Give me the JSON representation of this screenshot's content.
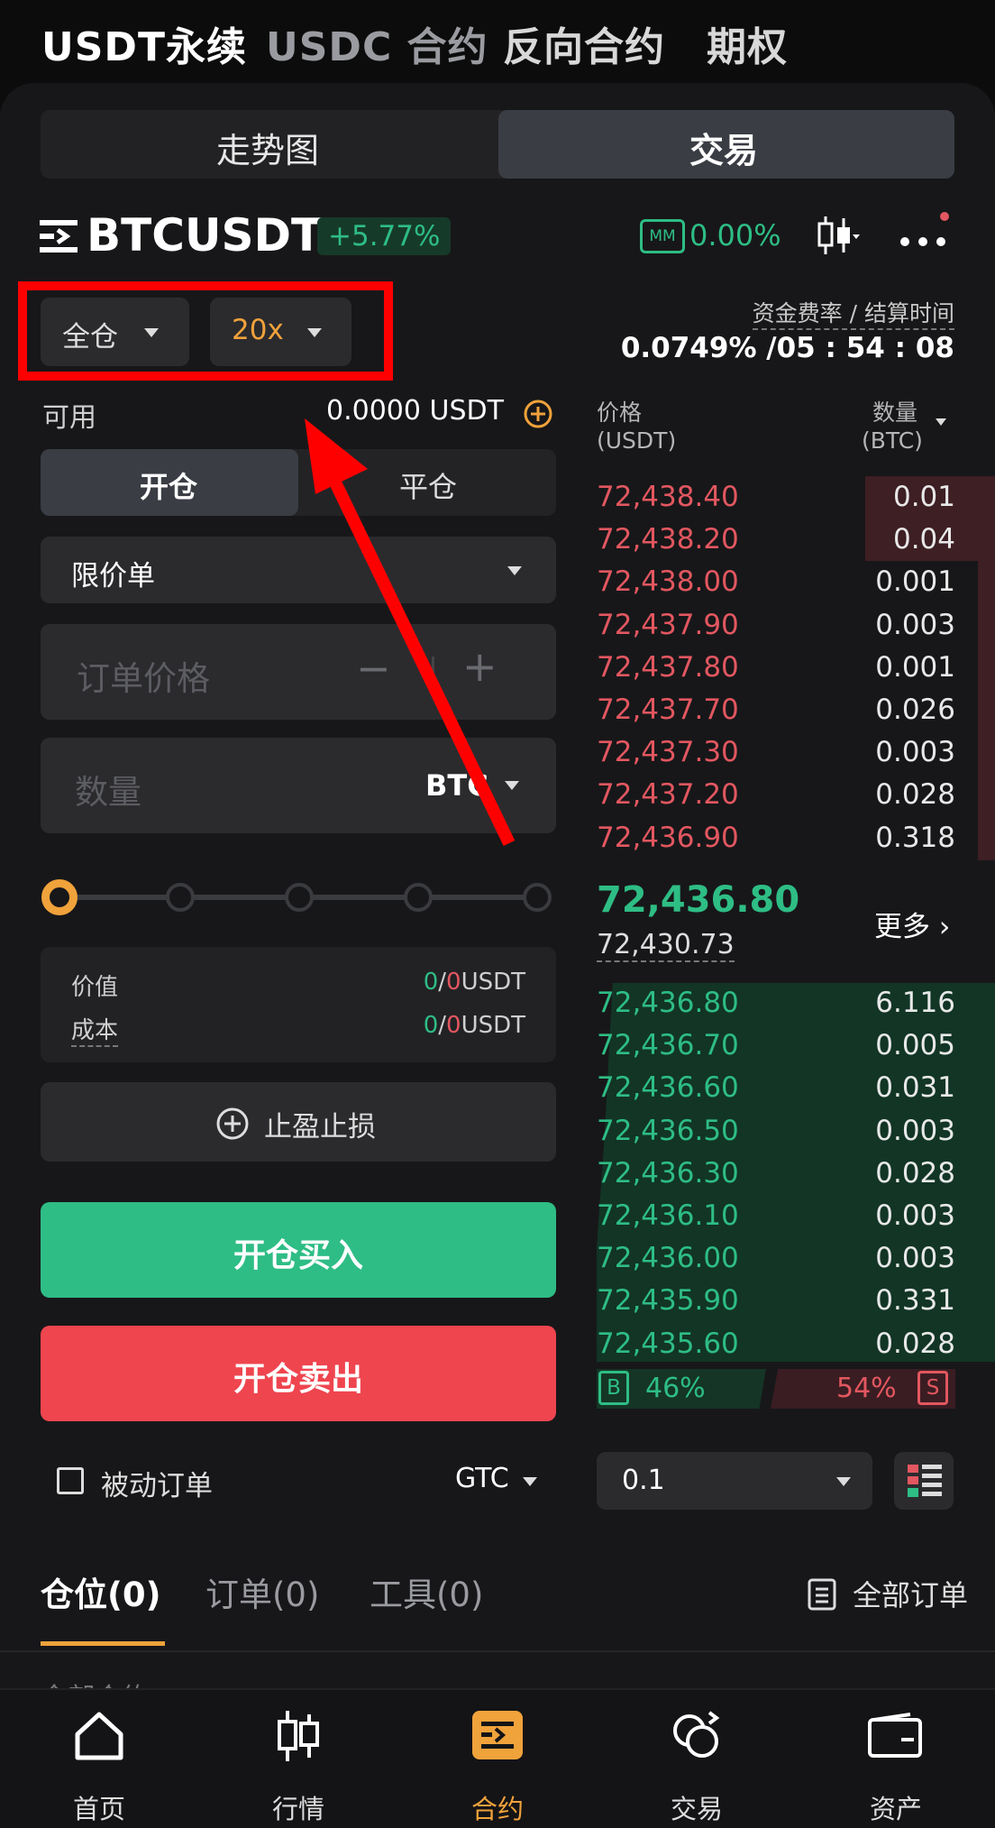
{
  "top_tabs": [
    "USDT永续",
    "USDC 合约",
    "反向合约",
    "期权"
  ],
  "view_tabs": {
    "chart": "走势图",
    "trade": "交易"
  },
  "symbol": {
    "name": "BTCUSDT",
    "change": "+5.77%",
    "mm_badge": "MM",
    "mm_value": "0.00%"
  },
  "margin": {
    "mode": "全仓",
    "leverage": "20x"
  },
  "funding": {
    "label": "资金费率 / 结算时间",
    "value": "0.0749% /05 : 54 : 08"
  },
  "available": {
    "label": "可用",
    "value": "0.0000 USDT"
  },
  "open_close": {
    "open": "开仓",
    "close": "平仓"
  },
  "order_type": "限价单",
  "price_input": {
    "placeholder": "订单价格",
    "minus": "−",
    "plus": "+"
  },
  "qty_input": {
    "placeholder": "数量",
    "unit": "BTC"
  },
  "slider_fraction": 0,
  "value_box": {
    "value_label": "价值",
    "value_green": "0",
    "value_slash": "/",
    "value_red": "0",
    "value_unit": "USDT",
    "cost_label": "成本",
    "cost_green": "0",
    "cost_slash": "/",
    "cost_red": "0",
    "cost_unit": "USDT"
  },
  "tpsl": "止盈止损",
  "buy_label": "开仓买入",
  "sell_label": "开仓卖出",
  "passive": {
    "label": "被动订单",
    "tif": "GTC"
  },
  "orderbook": {
    "price_header": "价格",
    "price_unit": "(USDT)",
    "qty_header": "数量",
    "qty_unit": "(BTC)",
    "asks": [
      [
        "72,438.40",
        "0.01"
      ],
      [
        "72,438.20",
        "0.04"
      ],
      [
        "72,438.00",
        "0.001"
      ],
      [
        "72,437.90",
        "0.003"
      ],
      [
        "72,437.80",
        "0.001"
      ],
      [
        "72,437.70",
        "0.026"
      ],
      [
        "72,437.30",
        "0.003"
      ],
      [
        "72,437.20",
        "0.028"
      ],
      [
        "72,436.90",
        "0.318"
      ]
    ],
    "last_price": "72,436.80",
    "mark_price": "72,430.73",
    "more": "更多 ›",
    "bids": [
      [
        "72,436.80",
        "6.116"
      ],
      [
        "72,436.70",
        "0.005"
      ],
      [
        "72,436.60",
        "0.031"
      ],
      [
        "72,436.50",
        "0.003"
      ],
      [
        "72,436.30",
        "0.028"
      ],
      [
        "72,436.10",
        "0.003"
      ],
      [
        "72,436.00",
        "0.003"
      ],
      [
        "72,435.90",
        "0.331"
      ],
      [
        "72,435.60",
        "0.028"
      ]
    ],
    "buy_badge": "B",
    "buy_pct": "46%",
    "sell_pct": "54%",
    "sell_badge": "S",
    "depth_step": "0.1"
  },
  "bottom_tabs": {
    "positions": "仓位(0)",
    "orders": "订单(0)",
    "tools": "工具(0)",
    "all_orders": "全部订单",
    "peek": "全部合约"
  },
  "nav": [
    "首页",
    "行情",
    "合约",
    "交易",
    "资产"
  ],
  "colors": {
    "green": "#2ebd85",
    "red": "#e25760",
    "orange": "#f0a23b",
    "annotation": "#ff0000"
  }
}
